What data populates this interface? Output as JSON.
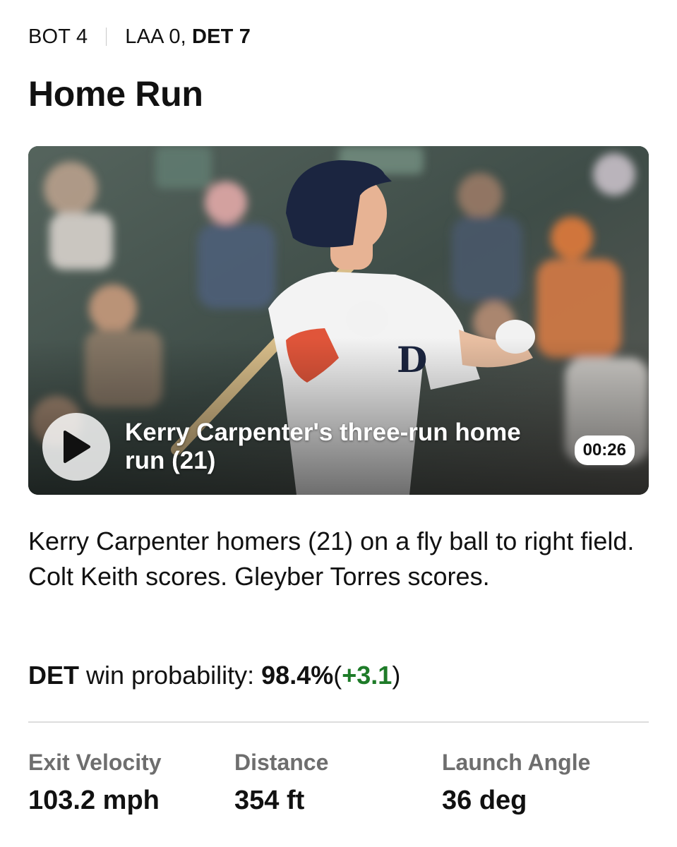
{
  "header": {
    "inning": "BOT 4",
    "away_score": "LAA 0,",
    "home_score": "DET 7"
  },
  "play_title": "Home Run",
  "video": {
    "title": "Kerry Carpenter's three-run home run (21)",
    "duration": "00:26",
    "play_icon": "play-icon"
  },
  "description": "Kerry Carpenter homers (21) on a fly ball to right field. Colt Keith scores. Gleyber Torres scores.",
  "win_probability": {
    "team": "DET",
    "label": "win probability:",
    "value": "98.4%",
    "open_paren": "(",
    "delta": "+3.1",
    "close_paren": ")"
  },
  "stats": [
    {
      "label": "Exit Velocity",
      "value": "103.2 mph"
    },
    {
      "label": "Distance",
      "value": "354 ft"
    },
    {
      "label": "Launch Angle",
      "value": "36 deg"
    }
  ],
  "colors": {
    "delta_positive": "#1e7b28",
    "label_gray": "#6e6e6e",
    "divider": "#dddddd"
  }
}
